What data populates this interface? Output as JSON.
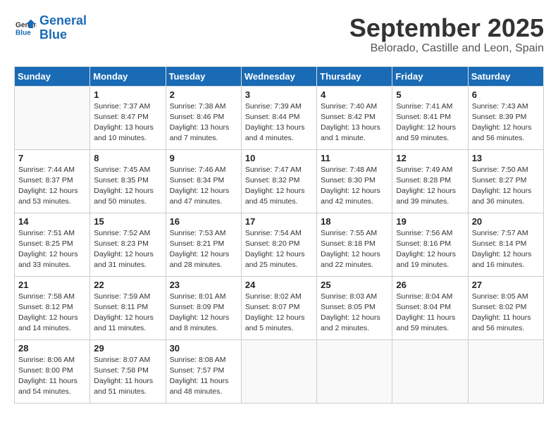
{
  "logo": {
    "line1": "General",
    "line2": "Blue"
  },
  "header": {
    "month": "September 2025",
    "location": "Belorado, Castille and Leon, Spain"
  },
  "weekdays": [
    "Sunday",
    "Monday",
    "Tuesday",
    "Wednesday",
    "Thursday",
    "Friday",
    "Saturday"
  ],
  "weeks": [
    [
      {
        "day": "",
        "info": ""
      },
      {
        "day": "1",
        "info": "Sunrise: 7:37 AM\nSunset: 8:47 PM\nDaylight: 13 hours\nand 10 minutes."
      },
      {
        "day": "2",
        "info": "Sunrise: 7:38 AM\nSunset: 8:46 PM\nDaylight: 13 hours\nand 7 minutes."
      },
      {
        "day": "3",
        "info": "Sunrise: 7:39 AM\nSunset: 8:44 PM\nDaylight: 13 hours\nand 4 minutes."
      },
      {
        "day": "4",
        "info": "Sunrise: 7:40 AM\nSunset: 8:42 PM\nDaylight: 13 hours\nand 1 minute."
      },
      {
        "day": "5",
        "info": "Sunrise: 7:41 AM\nSunset: 8:41 PM\nDaylight: 12 hours\nand 59 minutes."
      },
      {
        "day": "6",
        "info": "Sunrise: 7:43 AM\nSunset: 8:39 PM\nDaylight: 12 hours\nand 56 minutes."
      }
    ],
    [
      {
        "day": "7",
        "info": "Sunrise: 7:44 AM\nSunset: 8:37 PM\nDaylight: 12 hours\nand 53 minutes."
      },
      {
        "day": "8",
        "info": "Sunrise: 7:45 AM\nSunset: 8:35 PM\nDaylight: 12 hours\nand 50 minutes."
      },
      {
        "day": "9",
        "info": "Sunrise: 7:46 AM\nSunset: 8:34 PM\nDaylight: 12 hours\nand 47 minutes."
      },
      {
        "day": "10",
        "info": "Sunrise: 7:47 AM\nSunset: 8:32 PM\nDaylight: 12 hours\nand 45 minutes."
      },
      {
        "day": "11",
        "info": "Sunrise: 7:48 AM\nSunset: 8:30 PM\nDaylight: 12 hours\nand 42 minutes."
      },
      {
        "day": "12",
        "info": "Sunrise: 7:49 AM\nSunset: 8:28 PM\nDaylight: 12 hours\nand 39 minutes."
      },
      {
        "day": "13",
        "info": "Sunrise: 7:50 AM\nSunset: 8:27 PM\nDaylight: 12 hours\nand 36 minutes."
      }
    ],
    [
      {
        "day": "14",
        "info": "Sunrise: 7:51 AM\nSunset: 8:25 PM\nDaylight: 12 hours\nand 33 minutes."
      },
      {
        "day": "15",
        "info": "Sunrise: 7:52 AM\nSunset: 8:23 PM\nDaylight: 12 hours\nand 31 minutes."
      },
      {
        "day": "16",
        "info": "Sunrise: 7:53 AM\nSunset: 8:21 PM\nDaylight: 12 hours\nand 28 minutes."
      },
      {
        "day": "17",
        "info": "Sunrise: 7:54 AM\nSunset: 8:20 PM\nDaylight: 12 hours\nand 25 minutes."
      },
      {
        "day": "18",
        "info": "Sunrise: 7:55 AM\nSunset: 8:18 PM\nDaylight: 12 hours\nand 22 minutes."
      },
      {
        "day": "19",
        "info": "Sunrise: 7:56 AM\nSunset: 8:16 PM\nDaylight: 12 hours\nand 19 minutes."
      },
      {
        "day": "20",
        "info": "Sunrise: 7:57 AM\nSunset: 8:14 PM\nDaylight: 12 hours\nand 16 minutes."
      }
    ],
    [
      {
        "day": "21",
        "info": "Sunrise: 7:58 AM\nSunset: 8:12 PM\nDaylight: 12 hours\nand 14 minutes."
      },
      {
        "day": "22",
        "info": "Sunrise: 7:59 AM\nSunset: 8:11 PM\nDaylight: 12 hours\nand 11 minutes."
      },
      {
        "day": "23",
        "info": "Sunrise: 8:01 AM\nSunset: 8:09 PM\nDaylight: 12 hours\nand 8 minutes."
      },
      {
        "day": "24",
        "info": "Sunrise: 8:02 AM\nSunset: 8:07 PM\nDaylight: 12 hours\nand 5 minutes."
      },
      {
        "day": "25",
        "info": "Sunrise: 8:03 AM\nSunset: 8:05 PM\nDaylight: 12 hours\nand 2 minutes."
      },
      {
        "day": "26",
        "info": "Sunrise: 8:04 AM\nSunset: 8:04 PM\nDaylight: 11 hours\nand 59 minutes."
      },
      {
        "day": "27",
        "info": "Sunrise: 8:05 AM\nSunset: 8:02 PM\nDaylight: 11 hours\nand 56 minutes."
      }
    ],
    [
      {
        "day": "28",
        "info": "Sunrise: 8:06 AM\nSunset: 8:00 PM\nDaylight: 11 hours\nand 54 minutes."
      },
      {
        "day": "29",
        "info": "Sunrise: 8:07 AM\nSunset: 7:58 PM\nDaylight: 11 hours\nand 51 minutes."
      },
      {
        "day": "30",
        "info": "Sunrise: 8:08 AM\nSunset: 7:57 PM\nDaylight: 11 hours\nand 48 minutes."
      },
      {
        "day": "",
        "info": ""
      },
      {
        "day": "",
        "info": ""
      },
      {
        "day": "",
        "info": ""
      },
      {
        "day": "",
        "info": ""
      }
    ]
  ]
}
